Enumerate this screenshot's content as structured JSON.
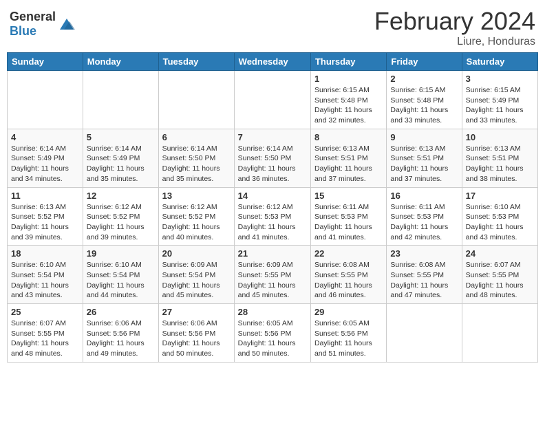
{
  "header": {
    "logo_general": "General",
    "logo_blue": "Blue",
    "month": "February 2024",
    "location": "Liure, Honduras"
  },
  "weekdays": [
    "Sunday",
    "Monday",
    "Tuesday",
    "Wednesday",
    "Thursday",
    "Friday",
    "Saturday"
  ],
  "weeks": [
    [
      {
        "day": "",
        "info": ""
      },
      {
        "day": "",
        "info": ""
      },
      {
        "day": "",
        "info": ""
      },
      {
        "day": "",
        "info": ""
      },
      {
        "day": "1",
        "info": "Sunrise: 6:15 AM\nSunset: 5:48 PM\nDaylight: 11 hours\nand 32 minutes."
      },
      {
        "day": "2",
        "info": "Sunrise: 6:15 AM\nSunset: 5:48 PM\nDaylight: 11 hours\nand 33 minutes."
      },
      {
        "day": "3",
        "info": "Sunrise: 6:15 AM\nSunset: 5:49 PM\nDaylight: 11 hours\nand 33 minutes."
      }
    ],
    [
      {
        "day": "4",
        "info": "Sunrise: 6:14 AM\nSunset: 5:49 PM\nDaylight: 11 hours\nand 34 minutes."
      },
      {
        "day": "5",
        "info": "Sunrise: 6:14 AM\nSunset: 5:49 PM\nDaylight: 11 hours\nand 35 minutes."
      },
      {
        "day": "6",
        "info": "Sunrise: 6:14 AM\nSunset: 5:50 PM\nDaylight: 11 hours\nand 35 minutes."
      },
      {
        "day": "7",
        "info": "Sunrise: 6:14 AM\nSunset: 5:50 PM\nDaylight: 11 hours\nand 36 minutes."
      },
      {
        "day": "8",
        "info": "Sunrise: 6:13 AM\nSunset: 5:51 PM\nDaylight: 11 hours\nand 37 minutes."
      },
      {
        "day": "9",
        "info": "Sunrise: 6:13 AM\nSunset: 5:51 PM\nDaylight: 11 hours\nand 37 minutes."
      },
      {
        "day": "10",
        "info": "Sunrise: 6:13 AM\nSunset: 5:51 PM\nDaylight: 11 hours\nand 38 minutes."
      }
    ],
    [
      {
        "day": "11",
        "info": "Sunrise: 6:13 AM\nSunset: 5:52 PM\nDaylight: 11 hours\nand 39 minutes."
      },
      {
        "day": "12",
        "info": "Sunrise: 6:12 AM\nSunset: 5:52 PM\nDaylight: 11 hours\nand 39 minutes."
      },
      {
        "day": "13",
        "info": "Sunrise: 6:12 AM\nSunset: 5:52 PM\nDaylight: 11 hours\nand 40 minutes."
      },
      {
        "day": "14",
        "info": "Sunrise: 6:12 AM\nSunset: 5:53 PM\nDaylight: 11 hours\nand 41 minutes."
      },
      {
        "day": "15",
        "info": "Sunrise: 6:11 AM\nSunset: 5:53 PM\nDaylight: 11 hours\nand 41 minutes."
      },
      {
        "day": "16",
        "info": "Sunrise: 6:11 AM\nSunset: 5:53 PM\nDaylight: 11 hours\nand 42 minutes."
      },
      {
        "day": "17",
        "info": "Sunrise: 6:10 AM\nSunset: 5:53 PM\nDaylight: 11 hours\nand 43 minutes."
      }
    ],
    [
      {
        "day": "18",
        "info": "Sunrise: 6:10 AM\nSunset: 5:54 PM\nDaylight: 11 hours\nand 43 minutes."
      },
      {
        "day": "19",
        "info": "Sunrise: 6:10 AM\nSunset: 5:54 PM\nDaylight: 11 hours\nand 44 minutes."
      },
      {
        "day": "20",
        "info": "Sunrise: 6:09 AM\nSunset: 5:54 PM\nDaylight: 11 hours\nand 45 minutes."
      },
      {
        "day": "21",
        "info": "Sunrise: 6:09 AM\nSunset: 5:55 PM\nDaylight: 11 hours\nand 45 minutes."
      },
      {
        "day": "22",
        "info": "Sunrise: 6:08 AM\nSunset: 5:55 PM\nDaylight: 11 hours\nand 46 minutes."
      },
      {
        "day": "23",
        "info": "Sunrise: 6:08 AM\nSunset: 5:55 PM\nDaylight: 11 hours\nand 47 minutes."
      },
      {
        "day": "24",
        "info": "Sunrise: 6:07 AM\nSunset: 5:55 PM\nDaylight: 11 hours\nand 48 minutes."
      }
    ],
    [
      {
        "day": "25",
        "info": "Sunrise: 6:07 AM\nSunset: 5:55 PM\nDaylight: 11 hours\nand 48 minutes."
      },
      {
        "day": "26",
        "info": "Sunrise: 6:06 AM\nSunset: 5:56 PM\nDaylight: 11 hours\nand 49 minutes."
      },
      {
        "day": "27",
        "info": "Sunrise: 6:06 AM\nSunset: 5:56 PM\nDaylight: 11 hours\nand 50 minutes."
      },
      {
        "day": "28",
        "info": "Sunrise: 6:05 AM\nSunset: 5:56 PM\nDaylight: 11 hours\nand 50 minutes."
      },
      {
        "day": "29",
        "info": "Sunrise: 6:05 AM\nSunset: 5:56 PM\nDaylight: 11 hours\nand 51 minutes."
      },
      {
        "day": "",
        "info": ""
      },
      {
        "day": "",
        "info": ""
      }
    ]
  ]
}
